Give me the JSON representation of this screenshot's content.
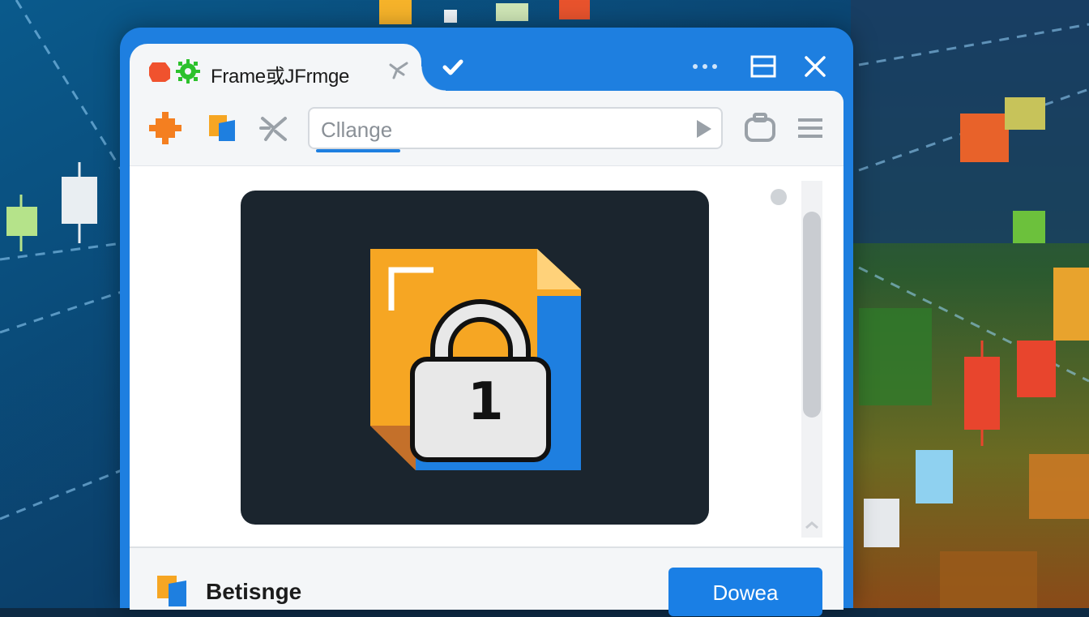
{
  "window": {
    "tab_title": "Frame或JFrmge",
    "accent_color": "#1e7fe0"
  },
  "toolbar": {
    "address_value": "Cllange",
    "icons": [
      "orange-gear-icon",
      "orange-blue-file-icon",
      "tools-icon",
      "go-arrow-icon",
      "briefcase-icon",
      "menu-icon"
    ]
  },
  "preview": {
    "image_name": "locked-file-icon",
    "lock_digit": "1"
  },
  "footer": {
    "label": "Betisnge",
    "button_label": "Dowea"
  },
  "colors": {
    "file_orange": "#f6a623",
    "file_blue": "#1e7fe0",
    "preview_bg": "#1b252e"
  }
}
